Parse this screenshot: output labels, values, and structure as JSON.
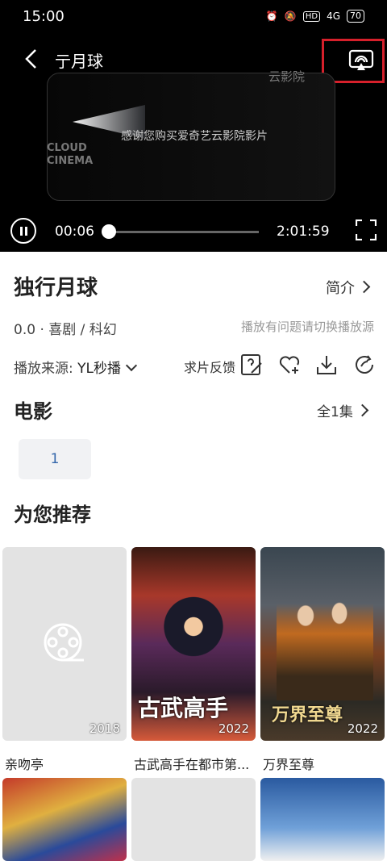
{
  "status": {
    "time": "15:00",
    "network": "4G",
    "hd": "HD",
    "battery": "70"
  },
  "player": {
    "title": "亍月球",
    "screen_brand": "云影院",
    "screen_text": "感谢您购买爱奇艺云影院影片",
    "screen_logo_line1": "CLOUD",
    "screen_logo_line2": "CINEMA",
    "current_time": "00:06",
    "duration": "2:01:59",
    "progress": 0.02
  },
  "movie": {
    "title": "独行月球",
    "intro_label": "简介",
    "meta": "0.0 · 喜剧 / 科幻",
    "hint": "播放有问题请切换播放源",
    "source_label": "播放来源:",
    "source_value": "YL秒播",
    "feedback_label": "求片反馈"
  },
  "episodes": {
    "title": "电影",
    "all_label": "全1集",
    "items": [
      "1"
    ]
  },
  "recommend": {
    "title": "为您推荐",
    "items": [
      {
        "name": "亲吻亭",
        "year": "2018"
      },
      {
        "name": "古武高手在都市第...",
        "year": "2022",
        "poster_text": "古武高手"
      },
      {
        "name": "万界至尊",
        "year": "2022",
        "poster_text": "万界至尊"
      }
    ]
  },
  "colors": {
    "highlight_box": "#d6202b",
    "episode_text": "#3366aa"
  }
}
